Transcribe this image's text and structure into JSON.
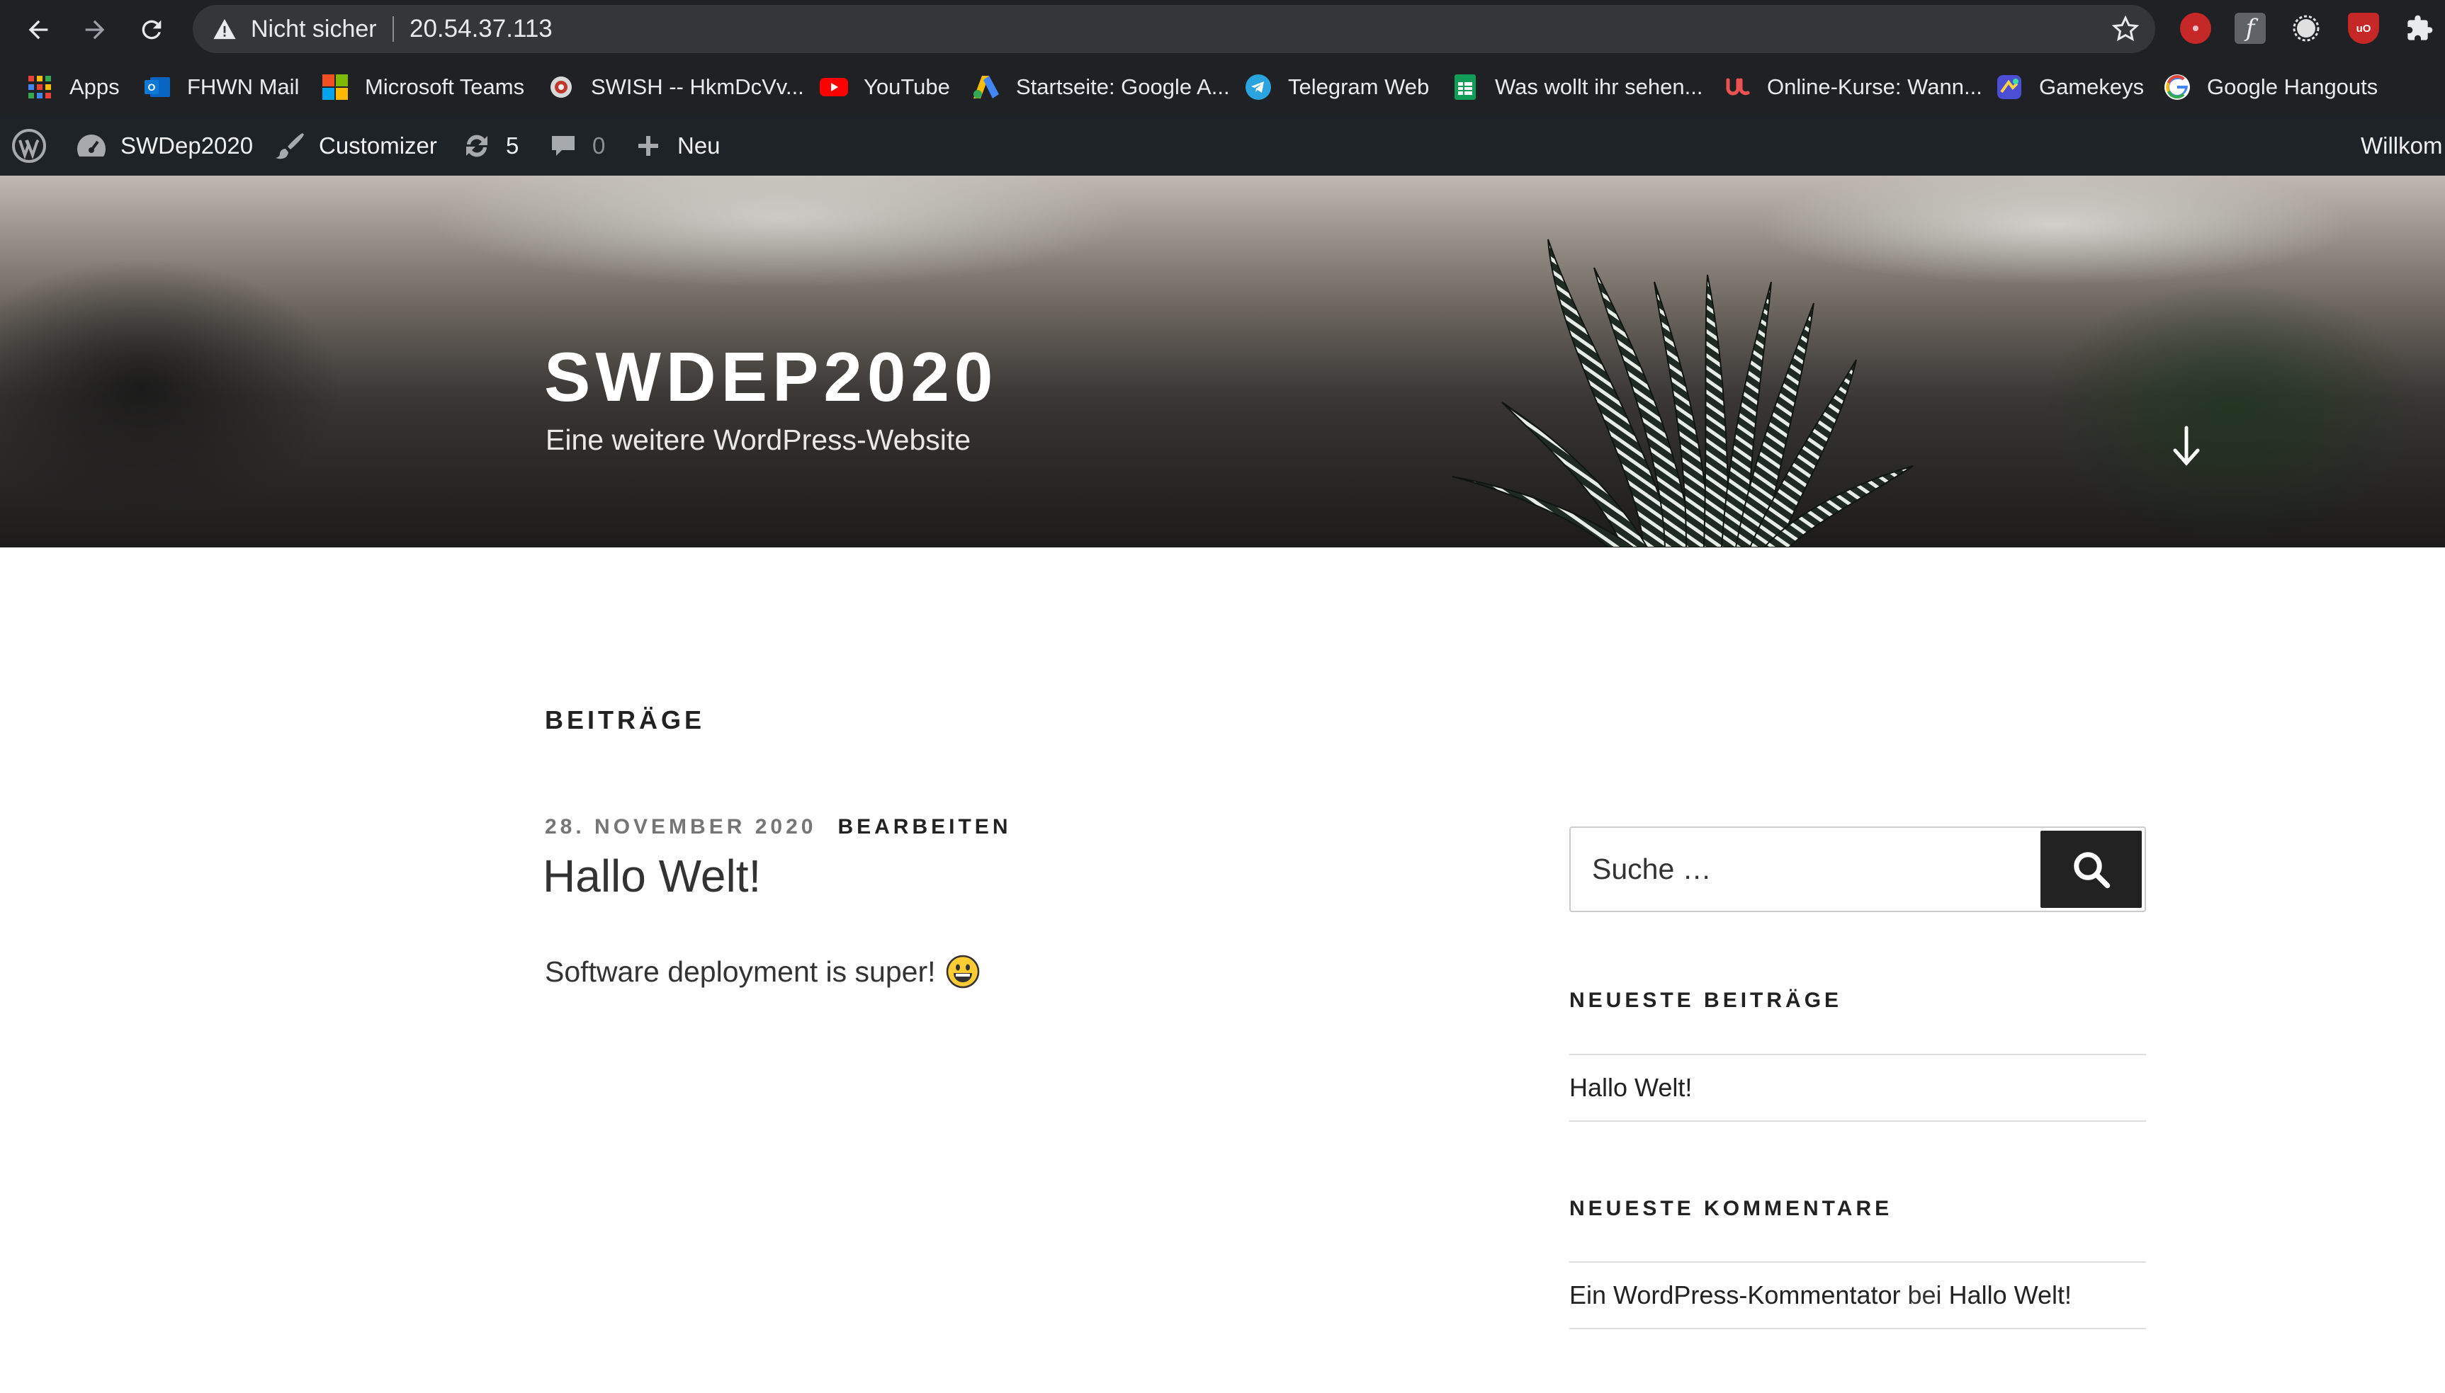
{
  "browser": {
    "nav": {
      "back": "back-arrow",
      "forward": "forward-arrow",
      "reload": "reload"
    },
    "omnibox": {
      "security_label": "Nicht sicher",
      "url": "20.54.37.113"
    },
    "bookmarks": [
      {
        "label": "Apps",
        "icon": "apps-grid-icon"
      },
      {
        "label": "FHWN Mail",
        "icon": "outlook-icon"
      },
      {
        "label": "Microsoft Teams",
        "icon": "microsoft-icon"
      },
      {
        "label": "SWISH -- HkmDcVv...",
        "icon": "swish-icon"
      },
      {
        "label": "YouTube",
        "icon": "youtube-icon"
      },
      {
        "label": "Startseite: Google A...",
        "icon": "google-ads-icon"
      },
      {
        "label": "Telegram Web",
        "icon": "telegram-icon"
      },
      {
        "label": "Was wollt ihr sehen...",
        "icon": "sheets-icon"
      },
      {
        "label": "Online-Kurse: Wann...",
        "icon": "udemy-icon"
      },
      {
        "label": "Gamekeys",
        "icon": "gamekeys-icon"
      },
      {
        "label": "Google Hangouts",
        "icon": "google-icon"
      }
    ]
  },
  "adminbar": {
    "site_name": "SWDep2020",
    "customizer": "Customizer",
    "updates_count": "5",
    "comments_count": "0",
    "new_label": "Neu",
    "greeting": "Willkom"
  },
  "header": {
    "title": "SWDEP2020",
    "description": "Eine weitere WordPress-Website"
  },
  "main": {
    "section_title": "BEITRÄGE",
    "post": {
      "date": "28. NOVEMBER 2020",
      "edit": "BEARBEITEN",
      "title": "Hallo Welt!",
      "body": "Software deployment is super!"
    }
  },
  "sidebar": {
    "search_placeholder": "Suche …",
    "recent_posts_title": "NEUESTE BEITRÄGE",
    "recent_posts": [
      "Hallo Welt!"
    ],
    "recent_comments_title": "NEUESTE KOMMENTARE",
    "comment": {
      "author": "Ein WordPress-Kommentator",
      "connector": "bei",
      "post": "Hallo Welt!"
    }
  },
  "colors": {
    "chrome_bg": "#202124",
    "omnibox_bg": "#35363a",
    "adminbar_bg": "#1d2327",
    "button_dark": "#222222"
  }
}
